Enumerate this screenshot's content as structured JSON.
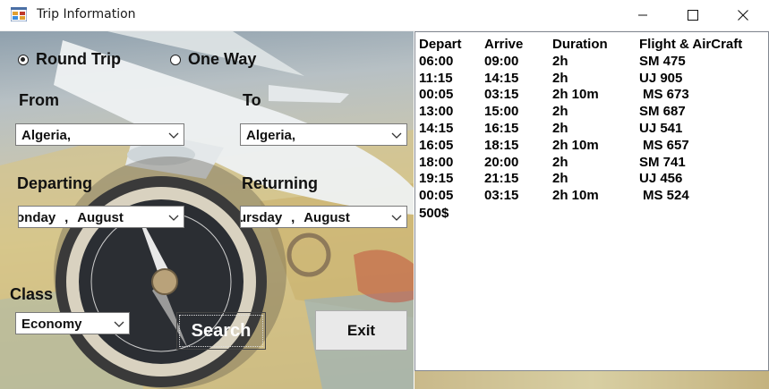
{
  "window": {
    "title": "Trip Information"
  },
  "trip_type": {
    "round_trip_label": "Round Trip",
    "one_way_label": "One Way",
    "selected": "Round Trip"
  },
  "from": {
    "label": "From",
    "value": "Algeria,"
  },
  "to": {
    "label": "To",
    "value": "Algeria,"
  },
  "departing": {
    "label": "Departing",
    "day": "onday",
    "sep": ",",
    "month": "August"
  },
  "returning": {
    "label": "Returning",
    "day": "ursday",
    "sep": ",",
    "month": "August"
  },
  "class": {
    "label": "Class",
    "value": "Economy"
  },
  "buttons": {
    "search": "Search",
    "exit": "Exit"
  },
  "results": {
    "headers": [
      "Depart",
      "Arrive",
      "Duration",
      "Flight & AirCraft"
    ],
    "rows": [
      [
        "06:00",
        "09:00",
        "2h",
        "SM 475"
      ],
      [
        "11:15",
        "14:15",
        "2h",
        "UJ 905"
      ],
      [
        "00:05",
        "03:15",
        "2h 10m",
        " MS 673"
      ],
      [
        "13:00",
        "15:00",
        "2h",
        "SM 687"
      ],
      [
        "14:15",
        "16:15",
        "2h",
        "UJ 541"
      ],
      [
        "16:05",
        "18:15",
        "2h 10m",
        " MS 657"
      ],
      [
        "18:00",
        "20:00",
        "2h",
        "SM 741"
      ],
      [
        "19:15",
        "21:15",
        "2h",
        "UJ 456"
      ],
      [
        "00:05",
        "03:15",
        "2h 10m",
        " MS 524"
      ]
    ],
    "total": "500$"
  },
  "icons": {
    "app": "app-window-icon",
    "minimize": "minimize-icon",
    "maximize": "maximize-icon",
    "close": "close-icon",
    "dropdown": "chevron-down-icon"
  }
}
